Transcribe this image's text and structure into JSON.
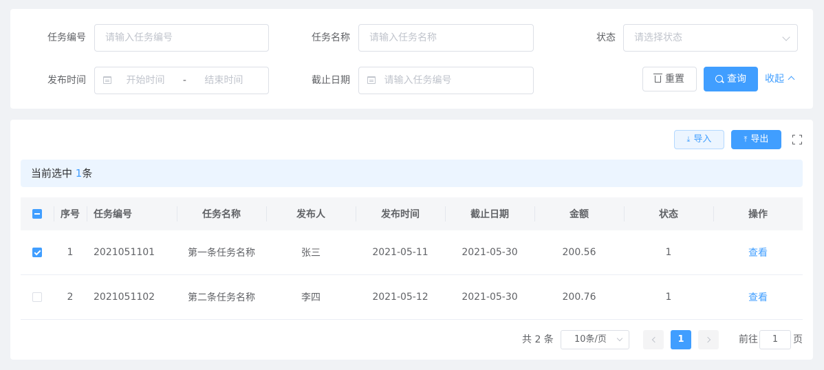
{
  "search": {
    "task_no": {
      "label": "任务编号",
      "placeholder": "请输入任务编号"
    },
    "task_name": {
      "label": "任务名称",
      "placeholder": "请输入任务名称"
    },
    "status": {
      "label": "状态",
      "placeholder": "请选择状态"
    },
    "publish_time": {
      "label": "发布时间",
      "start": "开始时间",
      "sep": "-",
      "end": "结束时间"
    },
    "deadline": {
      "label": "截止日期",
      "placeholder": "请输入任务编号"
    },
    "reset_label": "重置",
    "query_label": "查询",
    "collapse_label": "收起"
  },
  "toolbar": {
    "import_label": "导入",
    "export_label": "导出"
  },
  "selection": {
    "prefix": "当前选中",
    "count": "1",
    "suffix": "条"
  },
  "table": {
    "columns": [
      "序号",
      "任务编号",
      "任务名称",
      "发布人",
      "发布时间",
      "截止日期",
      "金额",
      "状态",
      "操作"
    ],
    "rows": [
      {
        "checked": true,
        "index": "1",
        "task_no": "2021051101",
        "task_name": "第一条任务名称",
        "publisher": "张三",
        "publish_time": "2021-05-11",
        "deadline": "2021-05-30",
        "amount": "200.56",
        "status": "1",
        "action": "查看"
      },
      {
        "checked": false,
        "index": "2",
        "task_no": "2021051102",
        "task_name": "第二条任务名称",
        "publisher": "李四",
        "publish_time": "2021-05-12",
        "deadline": "2021-05-30",
        "amount": "200.76",
        "status": "1",
        "action": "查看"
      }
    ]
  },
  "pagination": {
    "total": "共 2 条",
    "page_size": "10条/页",
    "current": "1",
    "goto_prefix": "前往",
    "goto_value": "1",
    "goto_suffix": "页"
  },
  "colors": {
    "primary": "#409eff",
    "selection_bg": "#ecf5ff",
    "header_bg": "#f5f6f8"
  }
}
